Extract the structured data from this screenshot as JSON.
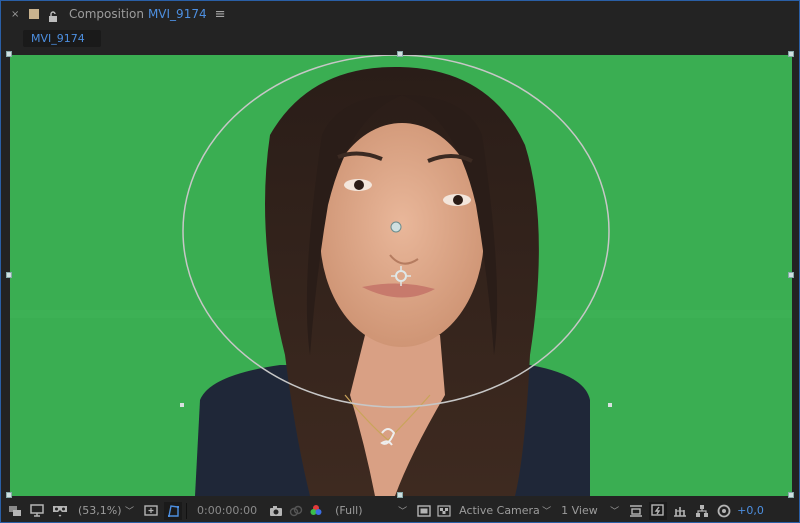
{
  "panel": {
    "close_glyph": "×",
    "title_prefix": "Composition",
    "comp_name": "MVI_9174",
    "menu_glyph": "≡",
    "lock_icon": "lock-icon",
    "swatch_color": "#c8b28e"
  },
  "tabs": [
    {
      "label": "MVI_9174",
      "active": true
    }
  ],
  "viewer": {
    "background_color": "#3aae52",
    "mask_shape": "ellipse",
    "content": "Woman in front of green screen with elliptical mask path"
  },
  "toolbar": {
    "magnification": "(53,1%)",
    "timecode": "0:00:00:00",
    "resolution": "(Full)",
    "camera": "Active Camera",
    "views": "1 View",
    "exposure": "+0,0",
    "icons": [
      "always-preview-icon",
      "monitor-icon",
      "vr-goggles-icon",
      "grid-guides-icon",
      "mask-visibility-icon",
      "snapshot-camera-icon",
      "show-snapshot-icon",
      "color-channels-icon",
      "region-of-interest-icon",
      "transparency-grid-icon",
      "pixel-aspect-icon",
      "fast-previews-icon",
      "timeline-icon",
      "flowchart-icon",
      "reset-exposure-icon"
    ]
  }
}
